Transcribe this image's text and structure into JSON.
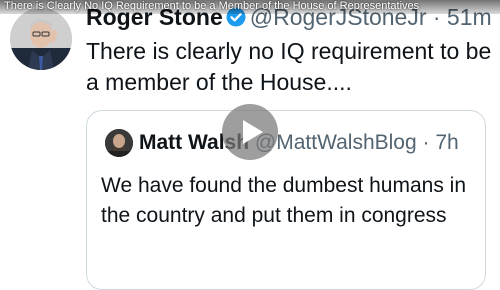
{
  "video": {
    "title": "There is Clearly No IQ Requirement to be a Member of the House of Representatives"
  },
  "tweet": {
    "author_name": "Roger Stone",
    "handle_time": "@RogerJStoneJr · 51m",
    "text": "There is clearly no IQ requirement to be a member of the House...."
  },
  "quoted_tweet": {
    "author_name": "Matt Walsh",
    "handle_time": "@MattWalshBlog · 7h",
    "text": "We have found the dumbest humans in the country and put them in congress"
  },
  "colors": {
    "verified_badge": "#1d9bf0",
    "text_primary": "#0f1419",
    "text_secondary": "#536471",
    "card_border": "#cfd9de"
  },
  "icons": {
    "verified": "verified-badge-icon",
    "play": "play-icon"
  }
}
